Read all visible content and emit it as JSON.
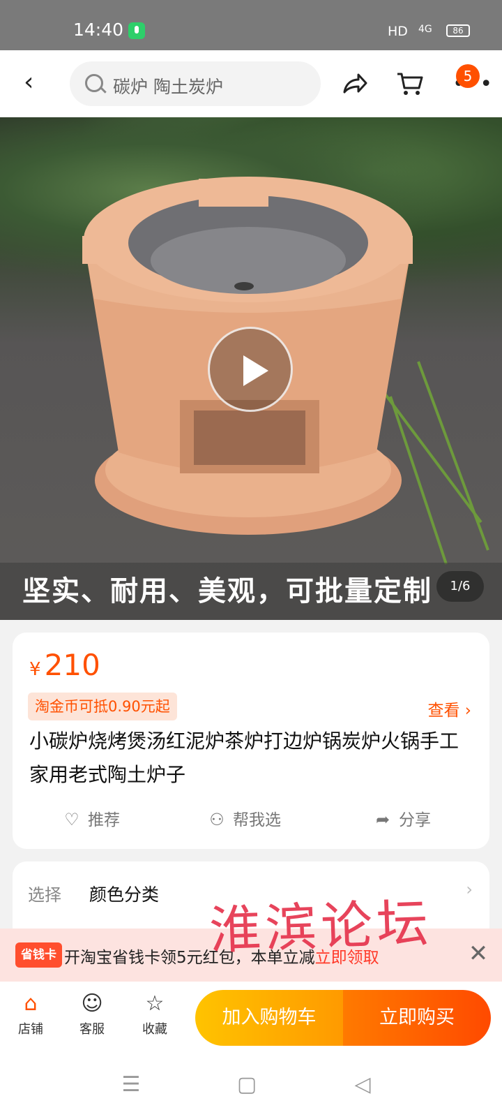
{
  "status_bar": {
    "time": "14:40",
    "network": "HD",
    "signal": "4G",
    "battery": "86"
  },
  "top_nav": {
    "search_text": "碳炉 陶土炭炉",
    "cart_badge": "5",
    "icons": [
      "back-icon",
      "search-icon",
      "share-icon",
      "cart-icon",
      "more-icon"
    ]
  },
  "hero": {
    "caption": "坚实、耐用、美观，可批量定制",
    "page_indicator": "1/6",
    "play_icon": "play-icon"
  },
  "product": {
    "currency": "¥",
    "price": "210",
    "coin_offer": "淘金币可抵0.90元起",
    "look_label": "查看 ›",
    "title": "小碳炉烧烤煲汤红泥炉茶炉打边炉锅炭炉火锅手工家用老式陶土炉子",
    "actions": [
      {
        "icon": "heart-icon",
        "label": "推荐"
      },
      {
        "icon": "people-icon",
        "label": "帮我选"
      },
      {
        "icon": "share-icon",
        "label": "分享"
      }
    ]
  },
  "options": {
    "label": "选择",
    "value": "颜色分类"
  },
  "watermark": "淮滨论坛",
  "promo": {
    "tag": "省钱卡",
    "message": "开淘宝省钱卡领5元红包，本单立减",
    "action": "立即领取"
  },
  "bottom_bar": {
    "tabs": [
      {
        "icon": "store-icon",
        "label": "店铺"
      },
      {
        "icon": "service-icon",
        "label": "客服"
      },
      {
        "icon": "star-icon",
        "label": "收藏"
      }
    ],
    "add_to_cart": "加入购物车",
    "buy_now": "立即购买"
  },
  "colors": {
    "accent": "#ff5000",
    "cart_button": "#ffa800",
    "buy_button": "#ff5a00"
  }
}
